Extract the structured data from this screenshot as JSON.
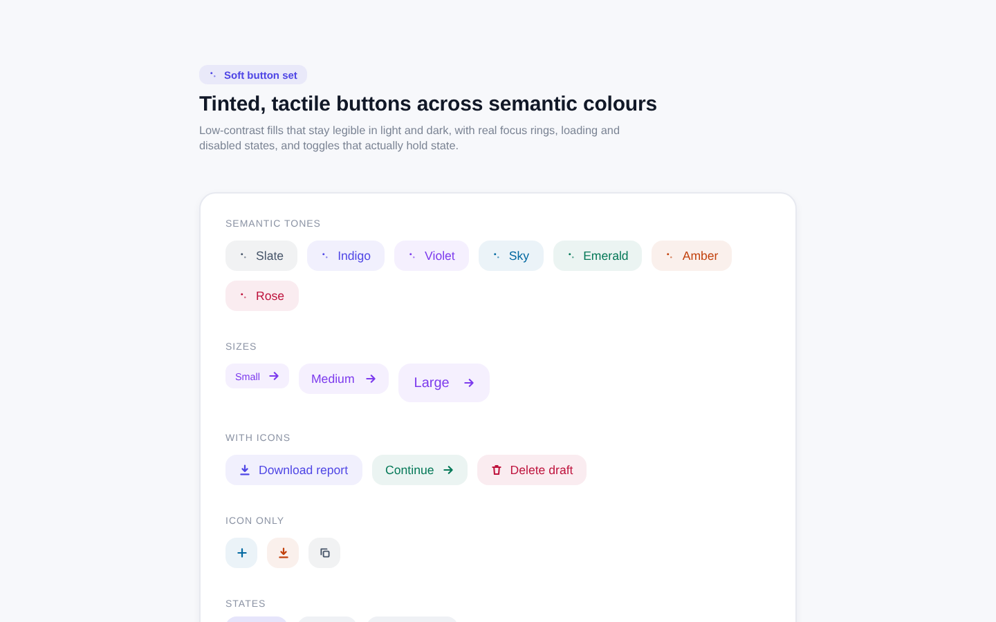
{
  "badge": {
    "label": "Soft button set",
    "color": "#4f46e5"
  },
  "title": "Tinted, tactile buttons across semantic colours",
  "subtitle": "Low-contrast fills that stay legible in light and dark, with real focus rings, loading and disabled states, and toggles that actually hold state.",
  "sections": [
    {
      "kind": "buttons",
      "label": "SEMANTIC TONES",
      "buttons": [
        {
          "label": "Slate",
          "color": "#475569",
          "kind": "tone"
        },
        {
          "label": "Indigo",
          "color": "#4f46e5",
          "kind": "tone"
        },
        {
          "label": "Violet",
          "color": "#7c3aed",
          "kind": "tone"
        },
        {
          "label": "Sky",
          "color": "#0369a1",
          "kind": "tone"
        },
        {
          "label": "Emerald",
          "color": "#047857",
          "kind": "tone"
        },
        {
          "label": "Amber",
          "color": "#c2410c",
          "kind": "tone"
        },
        {
          "label": "Rose",
          "color": "#be123c",
          "kind": "tone"
        }
      ]
    },
    {
      "kind": "buttons",
      "label": "SIZES",
      "buttons": [
        {
          "label": "Small",
          "color": "#7c3aed",
          "kind": "small"
        },
        {
          "label": "Medium",
          "color": "#7c3aed",
          "kind": "medium"
        },
        {
          "label": "Large",
          "color": "#7c3aed",
          "kind": "large"
        }
      ]
    },
    {
      "kind": "buttons",
      "label": "WITH ICONS",
      "buttons": [
        {
          "label": "Download report",
          "color": "#4f46e5",
          "kind": "download"
        },
        {
          "label": "Continue",
          "color": "#047857",
          "kind": "forward"
        },
        {
          "label": "Delete draft",
          "color": "#be123c",
          "kind": "delete"
        }
      ]
    },
    {
      "kind": "icons",
      "label": "ICON ONLY",
      "buttons": [
        {
          "kind": "add",
          "color": "#0369a1"
        },
        {
          "kind": "download",
          "color": "#c2410c"
        },
        {
          "kind": "copy",
          "color": "#475569"
        }
      ]
    },
    {
      "kind": "cut",
      "label": "STATES",
      "buttons": [
        {
          "color": "#e6e5fb"
        },
        {
          "color": "#eff1f5"
        },
        {
          "color": "#eff1f5"
        }
      ]
    }
  ]
}
